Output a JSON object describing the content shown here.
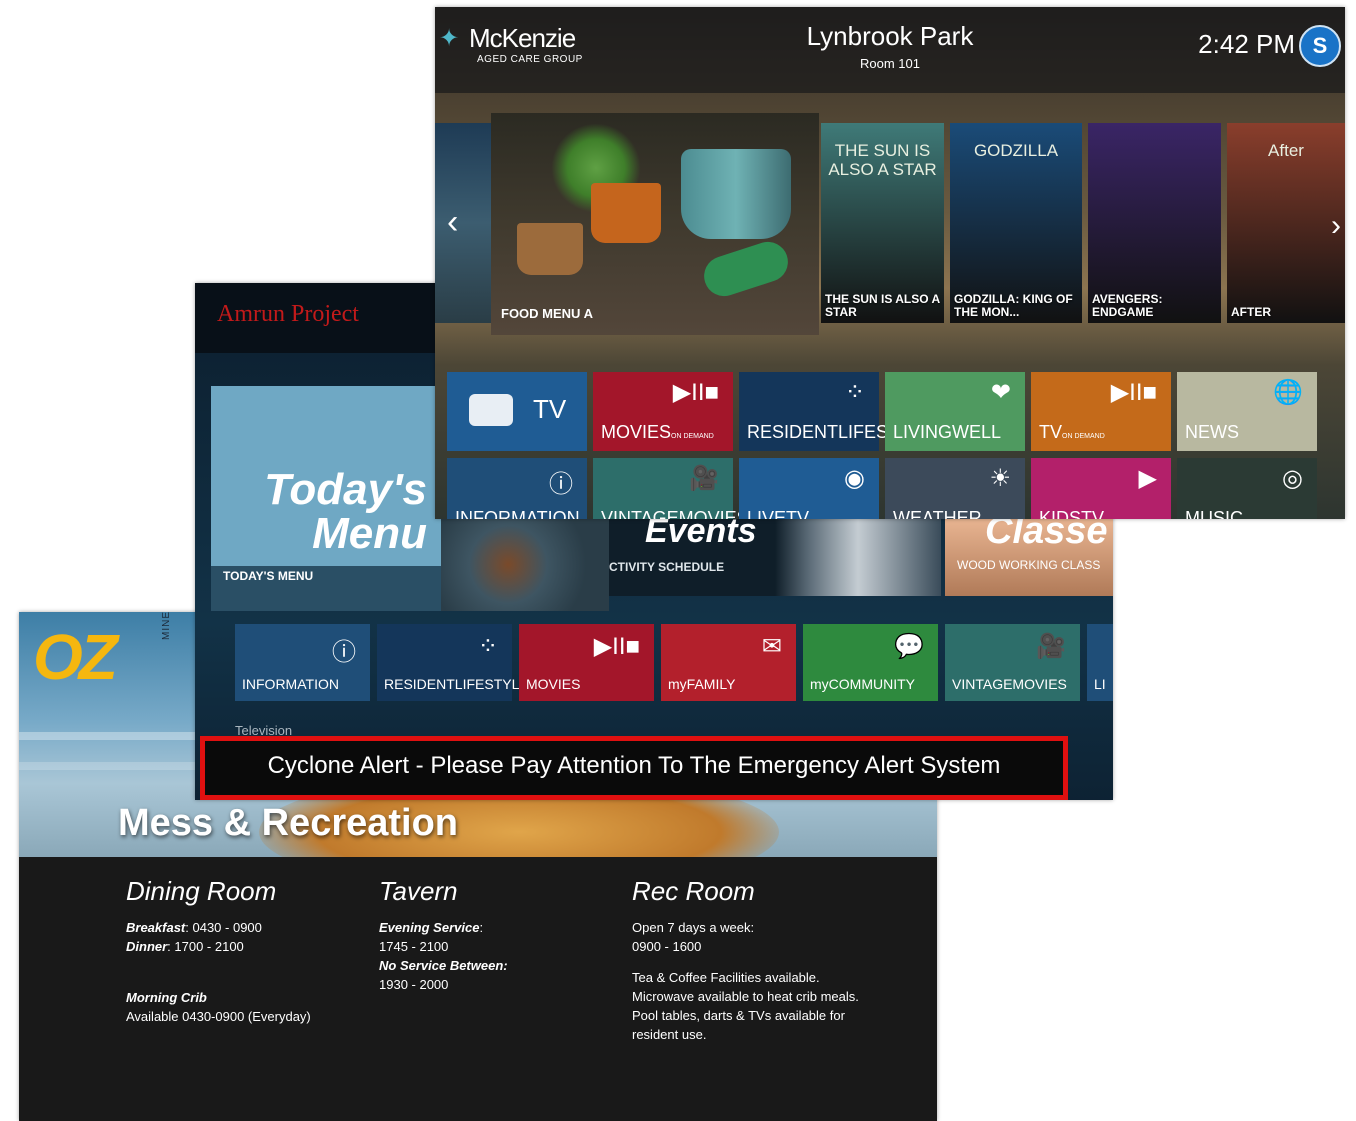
{
  "oz": {
    "logo_text": "OZ",
    "logo_sub": "MINERALS",
    "hero_title": "Mess & Recreation",
    "dining": {
      "title": "Dining Room",
      "breakfast_label": "Breakfast",
      "breakfast_time": ": 0430 - 0900",
      "dinner_label": "Dinner",
      "dinner_time": ": 1700 - 2100",
      "crib_label": "Morning Crib",
      "crib_time": "Available 0430-0900 (Everyday)"
    },
    "tavern": {
      "title": "Tavern",
      "service_label": "Evening Service",
      "service_colon": ":",
      "service_time": "1745 - 2100",
      "no_service_label": "No Service Between:",
      "no_service_time": "1930 - 2000"
    },
    "rec": {
      "title": "Rec Room",
      "open": "Open 7 days a week:",
      "hours": "0900 - 1600",
      "line1": "Tea & Coffee Facilities available.",
      "line2": "Microwave available to heat crib meals.",
      "line3": "Pool tables, darts & TVs available for",
      "line4": "resident use."
    }
  },
  "amrun": {
    "title": "Amrun Project",
    "menu_big_1": "Today's",
    "menu_big_2": "Menu",
    "menu_caption": "TODAY'S MENU",
    "events_title": "Events",
    "events_caption": "CTIVITY SCHEDULE",
    "classes_title": "Classe",
    "classes_caption": "WOOD WORKING CLASS",
    "tiles": [
      {
        "label": "INFORMATION",
        "icon": "ⓘ",
        "color": "#1f4e78"
      },
      {
        "label": "RESIDENTLIFESTYLE",
        "icon": "⁘",
        "color": "#14365a"
      },
      {
        "label": "MOVIES",
        "icon": "▶II■",
        "color": "#a3162a"
      },
      {
        "label": "myFAMILY",
        "icon": "✉",
        "color": "#b3202c"
      },
      {
        "label": "myCOMMUNITY",
        "icon": "💬",
        "color": "#2e8a3e"
      },
      {
        "label": "VINTAGEMOVIES",
        "icon": "🎥",
        "color": "#2d6e6a"
      },
      {
        "label": "LI",
        "icon": "",
        "color": "#1f4e78"
      }
    ],
    "tv_section": "Television",
    "alert": "Cyclone Alert - Please Pay Attention To The Emergency Alert System"
  },
  "mck": {
    "logo_name": "McKenzie",
    "logo_sub": "AGED CARE GROUP",
    "venue": "Lynbrook Park",
    "room": "Room 101",
    "time": "2:42 PM",
    "badge": "S",
    "food_label": "FOOD MENU A",
    "posters": [
      {
        "label": "THE SUN IS ALSO A STAR",
        "art": "THE SUN IS ALSO A STAR",
        "color": "#3f7a78"
      },
      {
        "label": "GODZILLA: KING OF THE MON...",
        "art": "GODZILLA",
        "color": "#1a4b78"
      },
      {
        "label": "AVENGERS: ENDGAME",
        "art": "",
        "color": "#3a2566"
      },
      {
        "label": "AFTER",
        "art": "After",
        "color": "#8a3e2c"
      }
    ],
    "row1": [
      {
        "label": "TV",
        "icon": "",
        "color": "#1f5c94"
      },
      {
        "label": "MOVIES",
        "sub": "ON DEMAND",
        "icon": "▶II■",
        "color": "#a3162a"
      },
      {
        "label": "RESIDENTLIFESTYLE",
        "icon": "⁘",
        "color": "#14365a"
      },
      {
        "label": "LIVINGWELL",
        "icon": "❤",
        "color": "#4f9a60"
      },
      {
        "label": "TV",
        "sub": "ON DEMAND",
        "icon": "▶II■",
        "color": "#c46a1a"
      },
      {
        "label": "NEWS",
        "icon": "🌐",
        "color": "#b8b8a0"
      }
    ],
    "row2": [
      {
        "label": "INFORMATION",
        "icon": "ⓘ",
        "color": "#1f4e78"
      },
      {
        "label": "VINTAGEMOVIES",
        "icon": "🎥",
        "color": "#2d6e6a"
      },
      {
        "label": "LIVETV",
        "icon": "◉",
        "color": "#1f5c94"
      },
      {
        "label": "WEATHER",
        "icon": "☀",
        "color": "#3c4a5a"
      },
      {
        "label": "KIDSTV",
        "icon": "▶",
        "color": "#b3206a"
      },
      {
        "label": "MUSIC",
        "icon": "◎",
        "color": "#2b3a34"
      }
    ]
  }
}
